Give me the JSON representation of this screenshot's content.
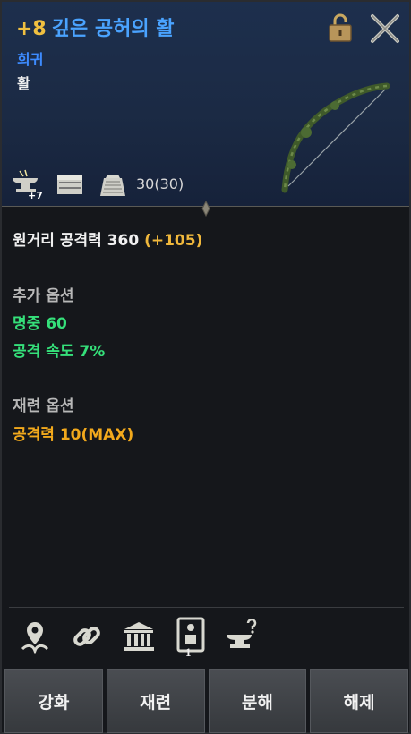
{
  "item": {
    "enhance": "+8",
    "name": "깊은 공허의 활",
    "grade": "희귀",
    "type": "활",
    "durability": "30(30)",
    "enhance_badge": "+7"
  },
  "stats": {
    "main_label": "원거리 공격력 360",
    "main_bonus": "(+105)",
    "extra_header": "추가 옵션",
    "extra": [
      "명중 60",
      "공격 속도 7%"
    ],
    "reroll_header": "재련 옵션",
    "reroll": [
      "공격력 10(MAX)"
    ]
  },
  "actions": {
    "icons": [
      "pin-leaf-icon",
      "chain-link-icon",
      "bank-icon",
      "character-card-icon",
      "anvil-question-icon"
    ],
    "icon_badge": "1",
    "buttons": [
      "강화",
      "재련",
      "분해",
      "해제"
    ]
  },
  "colors": {
    "header_bg": "#1b2a44",
    "enhance": "#f0c040",
    "name": "#4aa3ff",
    "grade": "#3d8bff",
    "bonus": "#f0b83c",
    "extra_option": "#35e07a",
    "reroll_option": "#f2a91c"
  }
}
